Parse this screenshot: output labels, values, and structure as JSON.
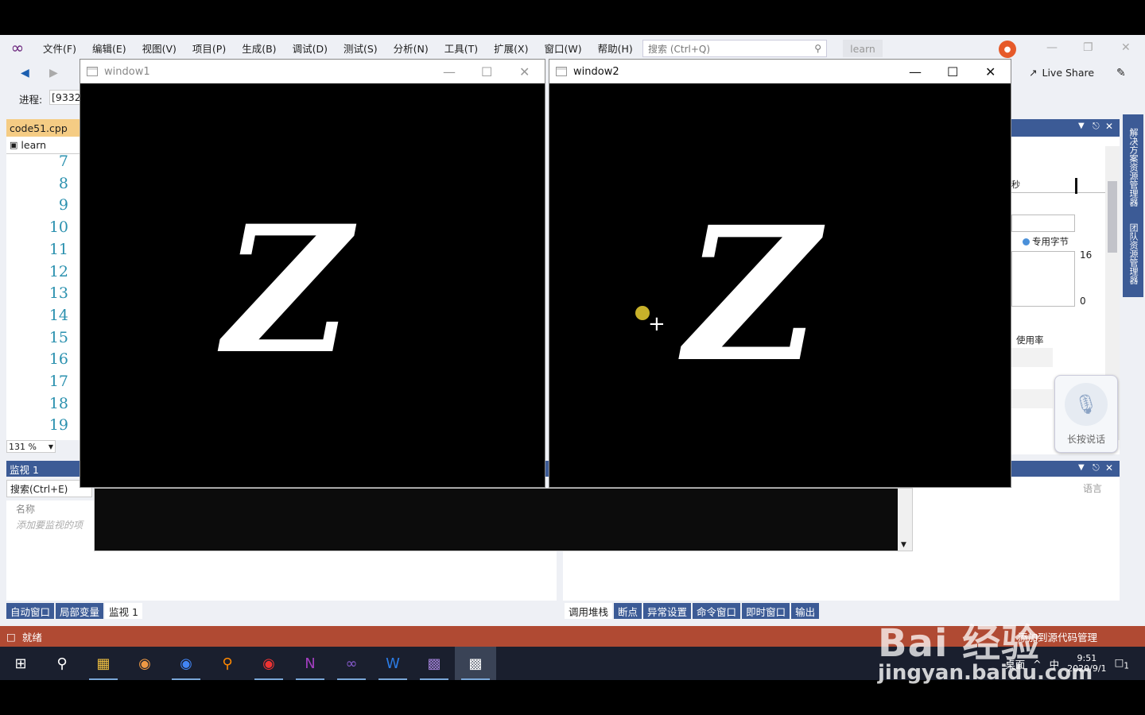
{
  "menu": [
    "文件(F)",
    "编辑(E)",
    "视图(V)",
    "项目(P)",
    "生成(B)",
    "调试(D)",
    "测试(S)",
    "分析(N)",
    "工具(T)",
    "扩展(X)",
    "窗口(W)",
    "帮助(H)"
  ],
  "search": {
    "placeholder": "搜索 (Ctrl+Q)"
  },
  "solution_name": "learn",
  "live_share": "Live Share",
  "process": {
    "label": "进程:",
    "value": "[9332]"
  },
  "editor": {
    "tab": "code51.cpp",
    "nav_scope": "learn",
    "line_numbers": [
      "7",
      "8",
      "9",
      "10",
      "11",
      "12",
      "13",
      "14",
      "15",
      "16",
      "17",
      "18",
      "19"
    ],
    "zoom": "131 %"
  },
  "right_panel": {
    "seconds_label": "秒",
    "private_bytes_label": "专用字节",
    "value_high": "16",
    "value_low": "0",
    "usage_label": "使用率",
    "vertical_tabs": [
      "解决方案资源管理器",
      "团队资源管理器"
    ]
  },
  "watch": {
    "title": "监视 1",
    "search_placeholder": "搜索(Ctrl+E)",
    "col_name": "名称",
    "add_hint": "添加要监视的项"
  },
  "callstack": {
    "lang_col": "语言"
  },
  "bottom_tabs_left": [
    "自动窗口",
    "局部变量",
    "监视 1"
  ],
  "bottom_tabs_right": [
    "调用堆栈",
    "断点",
    "异常设置",
    "命令窗口",
    "即时窗口",
    "输出"
  ],
  "status": "就绪",
  "status_right": "添加到源代码管理",
  "windows": [
    {
      "title": "window1",
      "letter": "Z"
    },
    {
      "title": "window2",
      "letter": "Z"
    }
  ],
  "mic_label": "长按说话",
  "tray": {
    "desktop": "桌面",
    "time": "9:51",
    "date": "2020/9/1",
    "ime": "中",
    "notif": "1"
  },
  "watermark": {
    "brand": "Bai 经验",
    "url": "jingyan.baidu.com"
  }
}
